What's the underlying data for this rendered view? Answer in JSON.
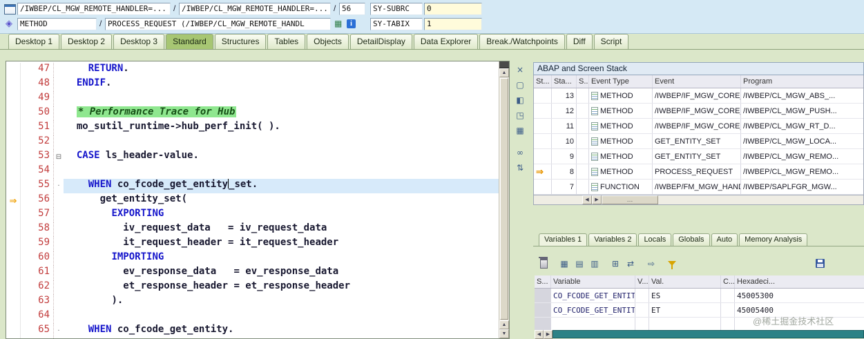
{
  "topbar": {
    "row1": {
      "nav1": "/IWBEP/CL_MGW_REMOTE_HANDLER=...",
      "sep1": "/",
      "nav2": "/IWBEP/CL_MGW_REMOTE_HANDLER=...",
      "sep2": "/",
      "line_no": "56",
      "sy_subrc_label": "SY-SUBRC",
      "sy_subrc_value": "0"
    },
    "row2": {
      "event_type": "METHOD",
      "sep": "/",
      "event_name": "PROCESS_REQUEST (/IWBEP/CL_MGW_REMOTE_HANDL",
      "sy_tabix_label": "SY-TABIX",
      "sy_tabix_value": "1"
    }
  },
  "tabs": {
    "items": [
      "Desktop 1",
      "Desktop 2",
      "Desktop 3",
      "Standard",
      "Structures",
      "Tables",
      "Objects",
      "DetailDisplay",
      "Data Explorer",
      "Break./Watchpoints",
      "Diff",
      "Script"
    ],
    "active": "Standard"
  },
  "editor": {
    "lines": [
      {
        "n": "47",
        "i": 4,
        "segs": [
          [
            "kw",
            "RETURN"
          ],
          [
            "pl",
            "."
          ]
        ]
      },
      {
        "n": "48",
        "i": 2,
        "segs": [
          [
            "kw",
            "ENDIF"
          ],
          [
            "pl",
            "."
          ]
        ]
      },
      {
        "n": "49",
        "i": 0,
        "segs": []
      },
      {
        "n": "50",
        "i": 2,
        "segs": [
          [
            "cm",
            "* Performance Trace for Hub"
          ]
        ]
      },
      {
        "n": "51",
        "i": 2,
        "segs": [
          [
            "pl",
            "mo_sutil_runtime->hub_perf_init( )."
          ]
        ]
      },
      {
        "n": "52",
        "i": 0,
        "segs": []
      },
      {
        "n": "53",
        "i": 2,
        "m": "fold",
        "segs": [
          [
            "kw",
            "CASE"
          ],
          [
            "pl",
            " ls_header-value."
          ]
        ]
      },
      {
        "n": "54",
        "i": 0,
        "segs": []
      },
      {
        "n": "55",
        "i": 4,
        "m": "dot",
        "hl": true,
        "caret_after": 1,
        "segs": [
          [
            "kw",
            "WHEN"
          ],
          [
            "pl",
            " co_fcode_get_entity"
          ],
          [
            "pl",
            "_set."
          ]
        ]
      },
      {
        "n": "56",
        "i": 6,
        "m": "arrow",
        "segs": [
          [
            "pl",
            "get_entity_set("
          ]
        ]
      },
      {
        "n": "57",
        "i": 8,
        "segs": [
          [
            "kw",
            "EXPORTING"
          ]
        ]
      },
      {
        "n": "58",
        "i": 10,
        "segs": [
          [
            "pl",
            "iv_request_data   = iv_request_data"
          ]
        ]
      },
      {
        "n": "59",
        "i": 10,
        "segs": [
          [
            "pl",
            "it_request_header = it_request_header"
          ]
        ]
      },
      {
        "n": "60",
        "i": 8,
        "segs": [
          [
            "kw",
            "IMPORTING"
          ]
        ]
      },
      {
        "n": "61",
        "i": 10,
        "segs": [
          [
            "pl",
            "ev_response_data   = ev_response_data"
          ]
        ]
      },
      {
        "n": "62",
        "i": 10,
        "segs": [
          [
            "pl",
            "et_response_header = et_response_header"
          ]
        ]
      },
      {
        "n": "63",
        "i": 8,
        "segs": [
          [
            "pl",
            ")."
          ]
        ]
      },
      {
        "n": "64",
        "i": 0,
        "segs": []
      },
      {
        "n": "65",
        "i": 4,
        "m": "dot",
        "segs": [
          [
            "kw",
            "WHEN"
          ],
          [
            "pl",
            " co_fcode_get_entity."
          ]
        ]
      }
    ],
    "toolbar_icons": [
      "close",
      "new-page",
      "window",
      "fullscreen",
      "layout"
    ],
    "toolbar_icons_lower": [
      "glasses",
      "table-sort"
    ]
  },
  "stack": {
    "title": "ABAP and Screen Stack",
    "columns": [
      "St...",
      "Sta...",
      "S..",
      "Event Type",
      "Event",
      "Program"
    ],
    "rows": [
      {
        "cur": false,
        "level": "13",
        "type": "METHOD",
        "event": "/IWBEP/IF_MGW_CORE_...",
        "program": "/IWBEP/CL_MGW_ABS_..."
      },
      {
        "cur": false,
        "level": "12",
        "type": "METHOD",
        "event": "/IWBEP/IF_MGW_CORE_...",
        "program": "/IWBEP/CL_MGW_PUSH..."
      },
      {
        "cur": false,
        "level": "11",
        "type": "METHOD",
        "event": "/IWBEP/IF_MGW_CORE_...",
        "program": "/IWBEP/CL_MGW_RT_D..."
      },
      {
        "cur": false,
        "level": "10",
        "type": "METHOD",
        "event": "GET_ENTITY_SET",
        "program": "/IWBEP/CL_MGW_LOCA..."
      },
      {
        "cur": false,
        "level": "9",
        "type": "METHOD",
        "event": "GET_ENTITY_SET",
        "program": "/IWBEP/CL_MGW_REMO..."
      },
      {
        "cur": true,
        "level": "8",
        "type": "METHOD",
        "event": "PROCESS_REQUEST",
        "program": "/IWBEP/CL_MGW_REMO..."
      },
      {
        "cur": false,
        "level": "7",
        "type": "FUNCTION",
        "event": "/IWBEP/FM_MGW_HAND...",
        "program": "/IWBEP/SAPLFGR_MGW..."
      }
    ]
  },
  "vars": {
    "tabs": [
      "Variables 1",
      "Variables 2",
      "Locals",
      "Globals",
      "Auto",
      "Memory Analysis"
    ],
    "active_tab": "Variables 1",
    "toolbar_icons": [
      "delete",
      "table",
      "table-settings",
      "table-save",
      "insert",
      "swap",
      "goto",
      "filter"
    ],
    "columns": [
      "S...",
      "Variable",
      "V...",
      "Val.",
      "C...",
      "Hexadeci..."
    ],
    "rows": [
      {
        "variable": "CO_FCODE_GET_ENTITY_SET",
        "val": "ES",
        "hex": "45005300"
      },
      {
        "variable": "CO_FCODE_GET_ENTITY",
        "val": "ET",
        "hex": "45005400"
      },
      {
        "variable": "",
        "val": "",
        "hex": ""
      }
    ]
  },
  "watermark": "@稀土掘金技术社区"
}
